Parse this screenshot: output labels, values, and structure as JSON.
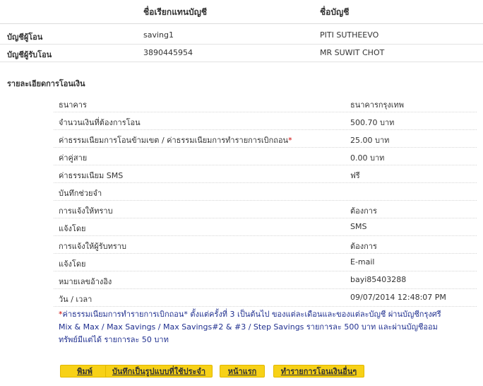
{
  "accounts_header": {
    "alias_col": "ชื่อเรียกแทนบัญชี",
    "name_col": "ชื่อบัญชี"
  },
  "accounts": [
    {
      "label": "บัญชีผู้โอน",
      "alias": "saving1",
      "name": "PITI SUTHEEVO"
    },
    {
      "label": "บัญชีผู้รับโอน",
      "alias": "3890445954",
      "name": "MR SUWIT CHOT"
    }
  ],
  "details_title": "รายละเอียดการโอนเงิน",
  "details": [
    {
      "key": "ธนาคาร",
      "value": "ธนาคารกรุงเทพ"
    },
    {
      "key": "จำนวนเงินที่ต้องการโอน",
      "value": "500.70 บาท"
    },
    {
      "key": "ค่าธรรมเนียมการโอนข้ามเขต / ค่าธรรมเนียมการทำรายการเบิกถอน",
      "key_mark": "*",
      "value": "25.00 บาท"
    },
    {
      "key": "ค่าคู่สาย",
      "value": "0.00 บาท"
    },
    {
      "key": "ค่าธรรมเนียม SMS",
      "value": "ฟรี"
    },
    {
      "key": "บันทึกช่วยจำ",
      "value": ""
    },
    {
      "key": "การแจ้งให้ทราบ",
      "value": "ต้องการ"
    },
    {
      "key": "แจ้งโดย",
      "value": "SMS"
    },
    {
      "key": "การแจ้งให้ผู้รับทราบ",
      "value": "ต้องการ"
    },
    {
      "key": "แจ้งโดย",
      "value": "E-mail"
    },
    {
      "key": "หมายเลขอ้างอิง",
      "value": "bayi85403288"
    },
    {
      "key": "วัน / เวลา",
      "value": "09/07/2014 12:48:07 PM"
    }
  ],
  "note": {
    "mark": "*",
    "text": "ค่าธรรมเนียมการทำรายการเบิกถอน* ตั้งแต่ครั้งที่ 3 เป็นต้นไป ของแต่ละเดือนและของแต่ละบัญชี ผ่านบัญชีกรุงศรี Mix & Max / Max Savings / Max Savings#2 & #3 / Step Savings รายการละ 500 บาท และผ่านบัญชีออมทรัพย์มีแต่ได้ รายการละ 50 บาท"
  },
  "buttons": {
    "print": "พิมพ์",
    "save_template": "บันทึกเป็นรูปแบบที่ใช้ประจำ",
    "home": "หน้าแรก",
    "other_transfer": "ทำรายการโอนเงินอื่นๆ"
  },
  "colors": {
    "button_bg": "#f7d117",
    "note_text": "#1f2f8f",
    "required_mark": "#cc0000"
  }
}
